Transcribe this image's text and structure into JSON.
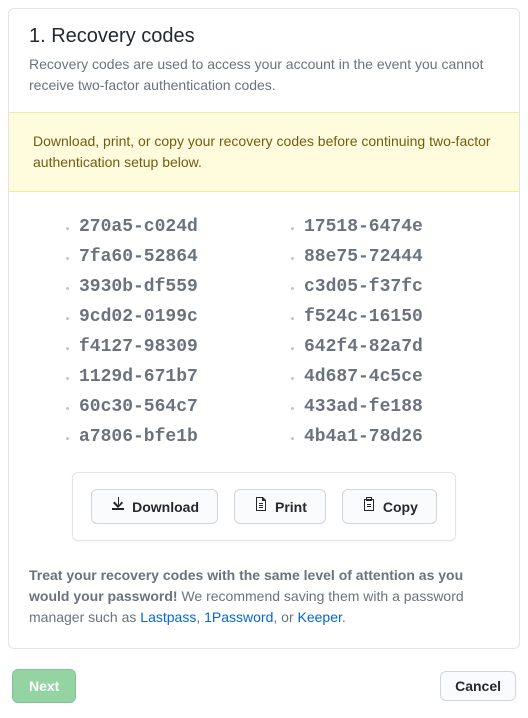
{
  "panel": {
    "title": "1. Recovery codes",
    "description": "Recovery codes are used to access your account in the event you cannot receive two-factor authentication codes."
  },
  "flash": "Download, print, or copy your recovery codes before continuing two-factor authentication setup below.",
  "codes": {
    "left": [
      "270a5-c024d",
      "7fa60-52864",
      "3930b-df559",
      "9cd02-0199c",
      "f4127-98309",
      "1129d-671b7",
      "60c30-564c7",
      "a7806-bfe1b"
    ],
    "right": [
      "17518-6474e",
      "88e75-72444",
      "c3d05-f37fc",
      "f524c-16150",
      "642f4-82a7d",
      "4d687-4c5ce",
      "433ad-fe188",
      "4b4a1-78d26"
    ]
  },
  "actions": {
    "download": "Download",
    "print": "Print",
    "copy": "Copy"
  },
  "warning": {
    "strong": "Treat your recovery codes with the same level of attention as you would your password!",
    "text_before_links": " We recommend saving them with a password manager such as ",
    "link1": "Lastpass",
    "sep1": ", ",
    "link2": "1Password",
    "sep2": ", or ",
    "link3": "Keeper",
    "after": "."
  },
  "footer": {
    "next": "Next",
    "cancel": "Cancel"
  }
}
